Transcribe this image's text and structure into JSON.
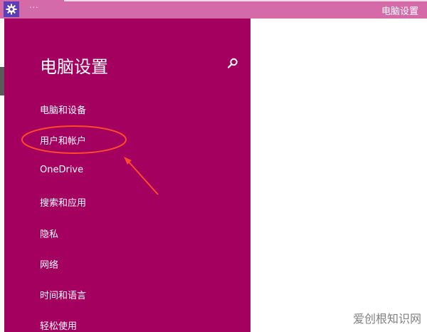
{
  "window": {
    "title": "电脑设置",
    "menu_dots": "···",
    "settings_icon": "gear-icon",
    "titlebar_color": "#d46aa8"
  },
  "panel": {
    "heading": "电脑设置",
    "search_icon": "search-icon",
    "background_color": "#a4005f",
    "items": [
      {
        "label": "电脑和设备"
      },
      {
        "label": "用户和帐户"
      },
      {
        "label": "OneDrive"
      },
      {
        "label": "搜索和应用"
      },
      {
        "label": "隐私"
      },
      {
        "label": "网络"
      },
      {
        "label": "时间和语言"
      },
      {
        "label": "轻松使用"
      }
    ]
  },
  "annotation": {
    "highlight_color": "#ff4a2a",
    "highlighted_item": "用户和帐户"
  },
  "watermark": {
    "text": "爱创根知识网"
  }
}
